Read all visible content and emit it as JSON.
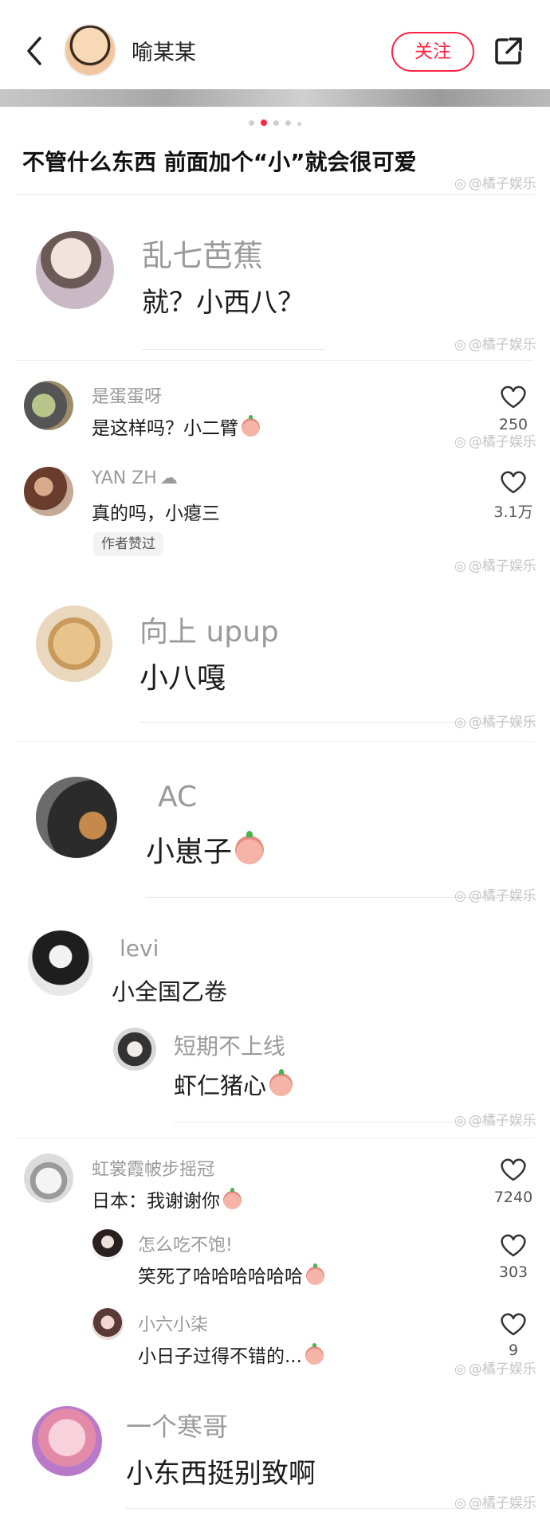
{
  "header": {
    "username": "喻某某",
    "follow_label": "关注",
    "icons": [
      "back-icon",
      "share-icon"
    ]
  },
  "post": {
    "title": "不管什么东西 前面加个“小”就会很可爱"
  },
  "watermark": "@橘子娱乐",
  "comments": [
    {
      "user": "乱七芭蕉",
      "text": "就？小西八？"
    },
    {
      "user": "是蛋蛋呀",
      "text": "是这样吗？小二臂",
      "likes": "250"
    },
    {
      "user": "YAN ZH",
      "text": "真的吗，小瘪三",
      "likes": "3.1万",
      "badge": "作者赞过"
    },
    {
      "user": "向上 upup",
      "text": "小八嘎"
    },
    {
      "user": "AC",
      "text": "小崽子"
    },
    {
      "user": "levi",
      "text": "小全国乙卷"
    },
    {
      "user": "短期不上线",
      "text": "虾仁猪心"
    },
    {
      "user": "虹裳霞帔步摇冠",
      "text": "日本：我谢谢你",
      "likes": "7240"
    },
    {
      "user": "怎么吃不饱!",
      "text": "笑死了哈哈哈哈哈哈",
      "likes": "303"
    },
    {
      "user": "小六小柒",
      "text": "小日子过得不错的...",
      "likes": "9"
    },
    {
      "user": "一个寒哥",
      "text": "小东西挺别致啊"
    }
  ],
  "colors": {
    "accent": "#ff2442",
    "username": "#9a9a9a",
    "text": "#1c1c1c"
  }
}
